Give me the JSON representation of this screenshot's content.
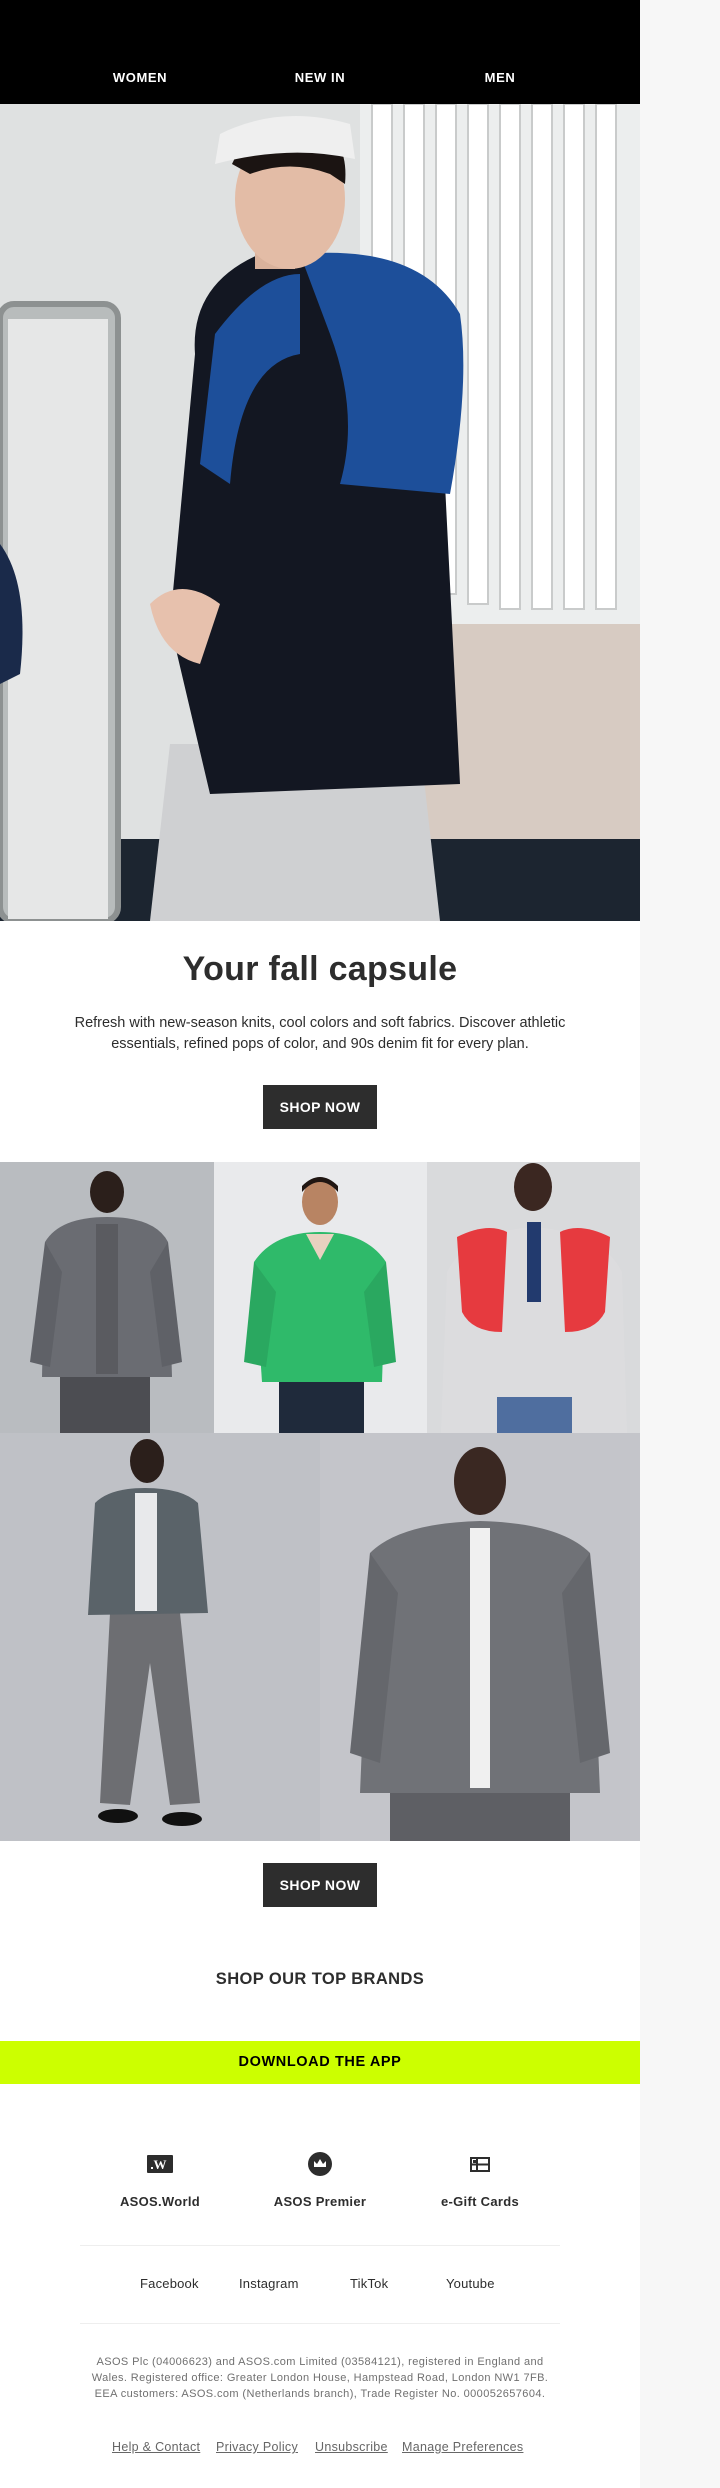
{
  "nav": {
    "women": "WOMEN",
    "new_in": "NEW IN",
    "men": "MEN"
  },
  "hero": {
    "image": "hero-image",
    "headline": "Your fall capsule",
    "subcopy": "Refresh with new-season knits, cool colors and soft fabrics. Discover athletic essentials, refined pops of color, and 90s denim fit for every plan.",
    "cta": "SHOP NOW"
  },
  "grid": {
    "images": [
      "grey-hoodie-jacket",
      "green-knit-jumper",
      "red-knit-over-shoulders",
      "grey-overshirt-outfit",
      "grey-zip-hoodie"
    ],
    "cta": "SHOP NOW"
  },
  "brands": {
    "heading": "SHOP OUR TOP BRANDS"
  },
  "app_banner": {
    "label": "DOWNLOAD THE APP",
    "color": "#ccff00"
  },
  "features": [
    {
      "label": "ASOS.World",
      "icon": "asos-world-icon"
    },
    {
      "label": "ASOS Premier",
      "icon": "crown-icon"
    },
    {
      "label": "e-Gift Cards",
      "icon": "gift-card-icon"
    }
  ],
  "social": [
    "Facebook",
    "Instagram",
    "TikTok",
    "Youtube"
  ],
  "legal": "ASOS Plc (04006623) and ASOS.com Limited (03584121), registered in England and Wales. Registered office: Greater London House, Hampstead Road, London NW1 7FB. EEA customers: ASOS.com (Netherlands branch), Trade Register No. 000052657604.",
  "footer_links": [
    "Help & Contact",
    "Privacy Policy",
    "Unsubscribe",
    "Manage Preferences"
  ],
  "colors": {
    "header_bg": "#000000",
    "button_bg": "#2d2d2d",
    "accent": "#ccff00",
    "text": "#2d2d2d"
  }
}
